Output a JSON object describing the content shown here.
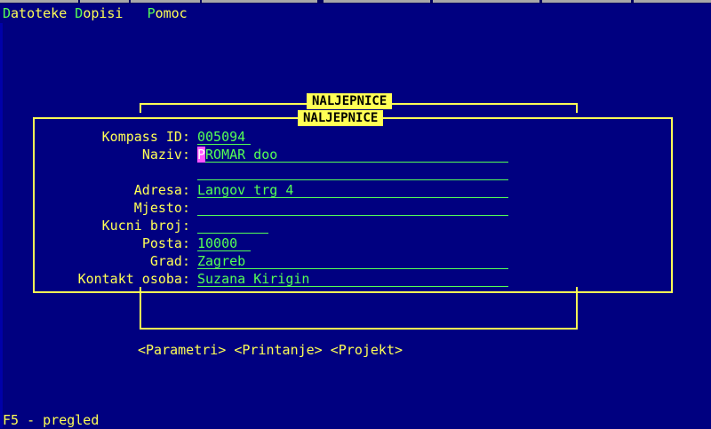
{
  "menu": [
    {
      "hot": "D",
      "rest": "atoteke"
    },
    {
      "hot": "D",
      "rest": "opisi"
    },
    {
      "hot": "P",
      "rest": "omoc"
    }
  ],
  "dialog": {
    "outer_title": "NALJEPNICE",
    "inner_title": "NALJEPNICE"
  },
  "form": {
    "kompass_id": {
      "label": "Kompass ID:",
      "value": "005094"
    },
    "naziv": {
      "label": "Naziv:",
      "cursor_char": "P",
      "value": "ROMAR doo"
    },
    "naziv2": {
      "label": "",
      "value": ""
    },
    "adresa": {
      "label": "Adresa:",
      "value": "Langov trg 4"
    },
    "mjesto": {
      "label": "Mjesto:",
      "value": ""
    },
    "kucni_broj": {
      "label": "Kucni broj:",
      "value": ""
    },
    "posta": {
      "label": "Posta:",
      "value": "10000"
    },
    "grad": {
      "label": "Grad:",
      "value": "Zagreb"
    },
    "kontakt": {
      "label": "Kontakt osoba:",
      "value": "Suzana Kirigin"
    }
  },
  "buttons": {
    "parametri": "<Parametri>",
    "printanje": "<Printanje>",
    "projekt": "<Projekt>"
  },
  "status": {
    "hint": "F5 - pregled"
  },
  "colors": {
    "background": "#000080",
    "text": "#ffff55",
    "field": "#55ff55",
    "cursor": "#ff55ff"
  }
}
